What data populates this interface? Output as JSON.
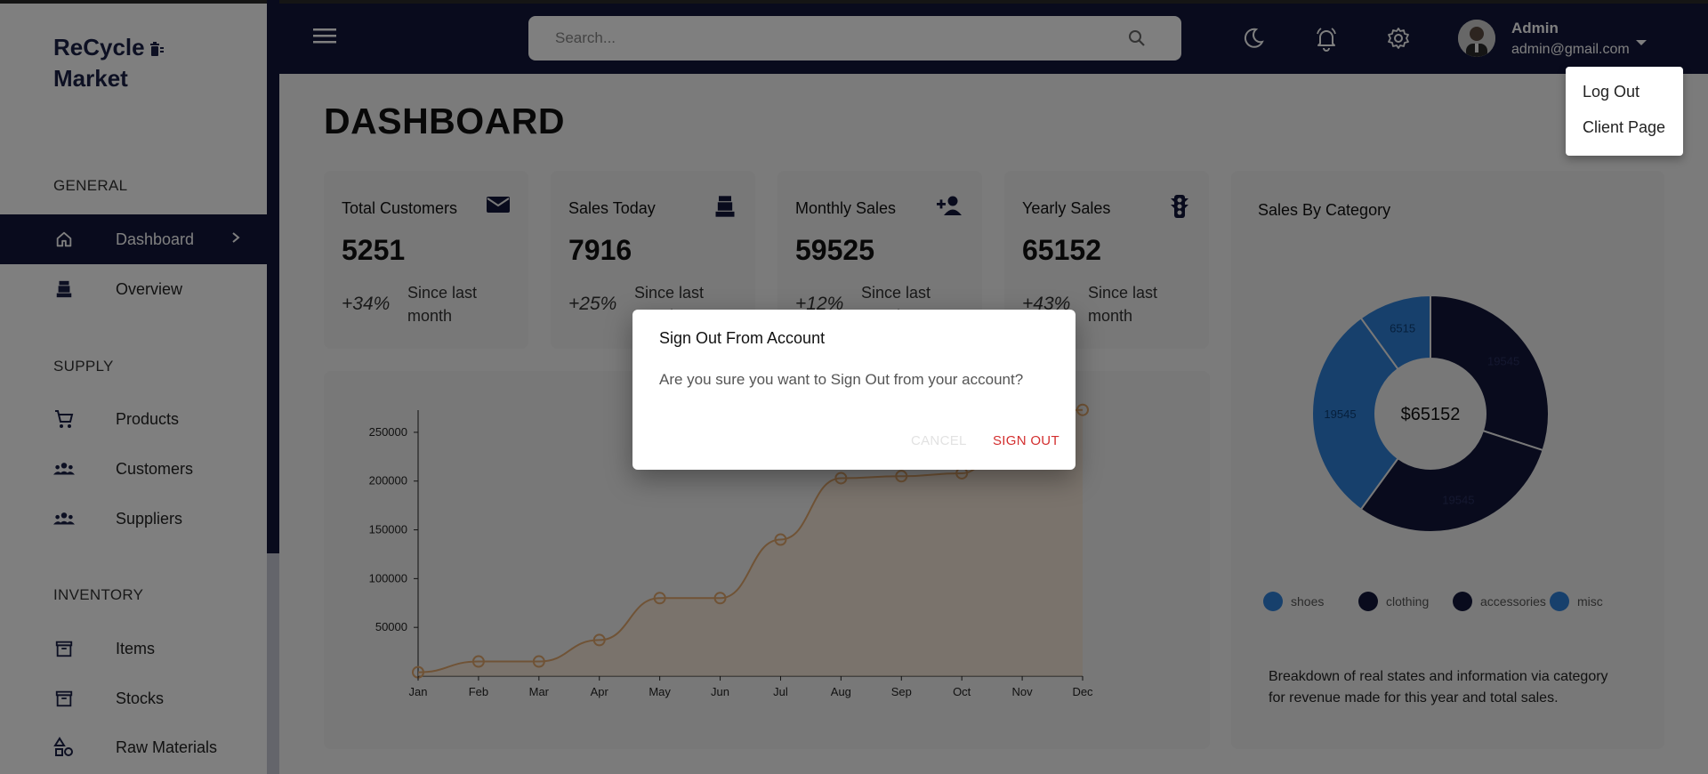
{
  "app": {
    "logo_line1": "ReCycle",
    "logo_line2": "Market"
  },
  "sidebar": {
    "sections": [
      {
        "heading": "GENERAL"
      },
      {
        "heading": "SUPPLY"
      },
      {
        "heading": "INVENTORY"
      }
    ],
    "items": [
      {
        "label": "Dashboard",
        "icon": "home-icon",
        "active": true
      },
      {
        "label": "Overview",
        "icon": "cash-register-icon"
      },
      {
        "label": "Products",
        "icon": "cart-icon"
      },
      {
        "label": "Customers",
        "icon": "group-icon"
      },
      {
        "label": "Suppliers",
        "icon": "group-icon"
      },
      {
        "label": "Items",
        "icon": "archive-icon"
      },
      {
        "label": "Stocks",
        "icon": "archive-icon"
      },
      {
        "label": "Raw Materials",
        "icon": "shapes-icon"
      }
    ]
  },
  "header": {
    "search_placeholder": "Search...",
    "user_name": "Admin",
    "user_email": "admin@gmail.com"
  },
  "user_menu": {
    "items": [
      "Log Out",
      "Client Page"
    ]
  },
  "page": {
    "title": "DASHBOARD"
  },
  "stats": [
    {
      "title": "Total Customers",
      "value": "5251",
      "delta": "+34%",
      "caption": "Since last month",
      "icon": "mail-icon"
    },
    {
      "title": "Sales Today",
      "value": "7916",
      "delta": "+25%",
      "caption": "Since last month",
      "icon": "cash-register-icon"
    },
    {
      "title": "Monthly Sales",
      "value": "59525",
      "delta": "+12%",
      "caption": "Since last month",
      "icon": "person-add-icon"
    },
    {
      "title": "Yearly Sales",
      "value": "65152",
      "delta": "+43%",
      "caption": "Since last month",
      "icon": "traffic-icon"
    }
  ],
  "category": {
    "title": "Sales By Category",
    "center_label": "$65152",
    "description": "Breakdown of real states and information via category for revenue made for this year and total sales."
  },
  "dialog": {
    "title": "Sign Out From Account",
    "text": "Are you sure you want to Sign Out from your account?",
    "cancel": "CANCEL",
    "confirm": "SIGN OUT"
  },
  "colors": {
    "navy": "#12173b",
    "accent_blue": "#2f80d9",
    "line_orange": "#e0a76c",
    "danger": "#d32f2f"
  },
  "chart_data": [
    {
      "type": "area",
      "x": [
        "Jan",
        "Feb",
        "Mar",
        "Apr",
        "May",
        "Jun",
        "Jul",
        "Aug",
        "Sep",
        "Oct",
        "Nov",
        "Dec"
      ],
      "series": [
        {
          "values": [
            4000,
            15000,
            15000,
            37000,
            80000,
            80000,
            140000,
            203000,
            205000,
            208000,
            270000,
            273000
          ]
        }
      ],
      "yticks": [
        50000,
        100000,
        150000,
        200000,
        250000
      ],
      "ylim": [
        0,
        270000
      ]
    },
    {
      "type": "pie",
      "categories": [
        "shoes",
        "clothing",
        "accessories",
        "misc"
      ],
      "values": [
        6515,
        19545,
        19545,
        19545
      ],
      "slice_labels": [
        "6515",
        "19545",
        "19545",
        "19545"
      ],
      "colors": [
        "#2f80d9",
        "#12173b",
        "#12173b",
        "#2f80d9"
      ]
    }
  ]
}
